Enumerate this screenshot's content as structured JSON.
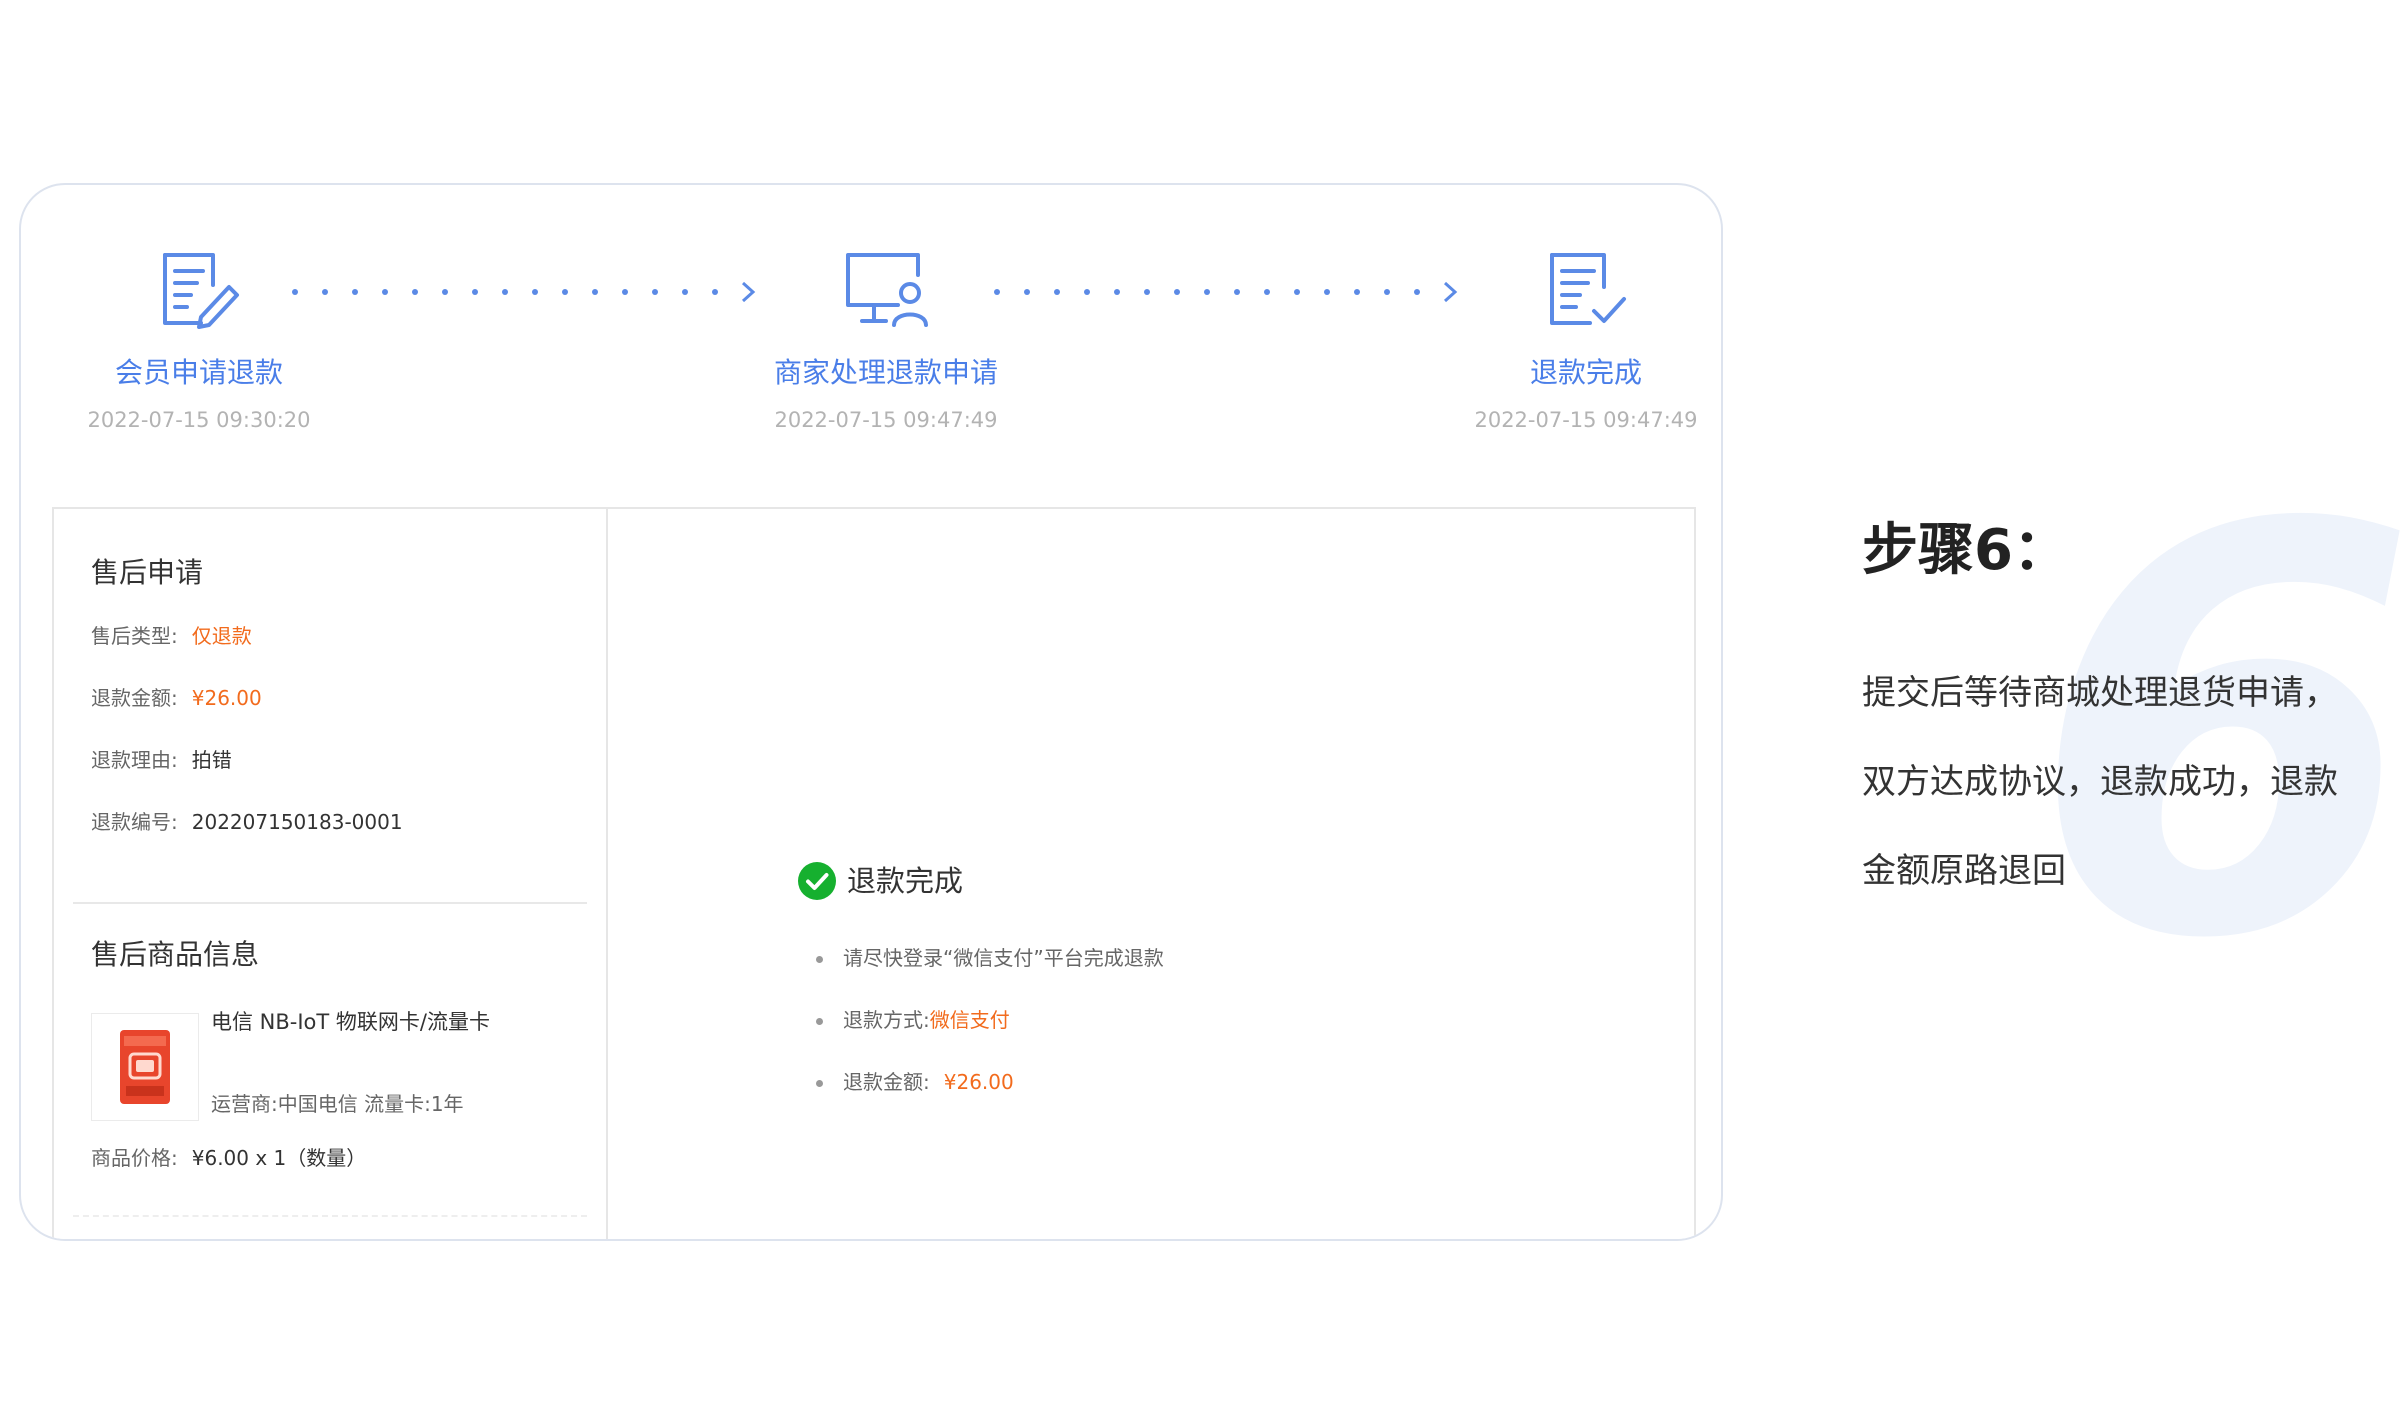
{
  "steps": [
    {
      "label": "会员申请退款",
      "time": "2022-07-15 09:30:20",
      "icon": "document-edit-icon"
    },
    {
      "label": "商家处理退款申请",
      "time": "2022-07-15 09:47:49",
      "icon": "monitor-user-icon"
    },
    {
      "label": "退款完成",
      "time": "2022-07-15 09:47:49",
      "icon": "document-check-icon"
    }
  ],
  "after_sale": {
    "title": "售后申请",
    "type_label": "售后类型:",
    "type_value": "仅退款",
    "amount_label": "退款金额:",
    "amount_value": "¥26.00",
    "reason_label": "退款理由:",
    "reason_value": "拍错",
    "number_label": "退款编号:",
    "number_value": "202207150183-0001"
  },
  "product": {
    "title": "售后商品信息",
    "name": "电信 NB-IoT 物联网卡/流量卡",
    "sub": "运营商:中国电信 流量卡:1年",
    "price_label": "商品价格:",
    "price_value": "¥6.00 x 1（数量）",
    "thumb_icon": "sim-card-icon"
  },
  "result": {
    "status": "退款完成",
    "notes": [
      {
        "text": "请尽快登录“微信支付”平台完成退款",
        "label": "",
        "value": ""
      },
      {
        "text": "",
        "label": "退款方式:",
        "value": "微信支付"
      },
      {
        "text": "",
        "label": "退款金额:",
        "value": "¥26.00"
      }
    ]
  },
  "explain": {
    "title": "步骤6：",
    "lines": [
      "提交后等待商城处理退货申请，",
      "双方达成协议，退款成功，退款",
      "金额原路退回"
    ],
    "big_number": "6"
  },
  "colors": {
    "accent": "#4a7ee8",
    "orange": "#f26b1d",
    "success": "#16b02f"
  }
}
